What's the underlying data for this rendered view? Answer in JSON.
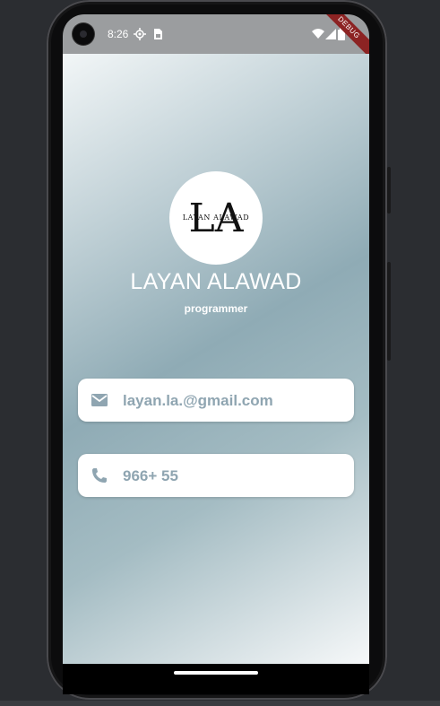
{
  "status_bar": {
    "time": "8:26",
    "debug_label": "DEBUG",
    "icons": [
      "gps-icon",
      "sim-card-icon",
      "wifi-icon",
      "signal-icon",
      "battery-icon"
    ]
  },
  "profile": {
    "logo_letters": "LA",
    "logo_text": "LAYAN ALAWAD",
    "name": "LAYAN ALAWAD",
    "role": "programmer"
  },
  "contacts": [
    {
      "icon": "email-icon",
      "value": "layan.la.@gmail.com"
    },
    {
      "icon": "phone-icon",
      "value": "966+ 55"
    }
  ],
  "colors": {
    "gradient_start": "#f2f6f7",
    "gradient_mid": "#8fabb5",
    "gradient_end": "#f6f8f9",
    "card_background": "#ffffff",
    "card_text": "#8fa5b1",
    "debug_banner": "#8c2323"
  }
}
